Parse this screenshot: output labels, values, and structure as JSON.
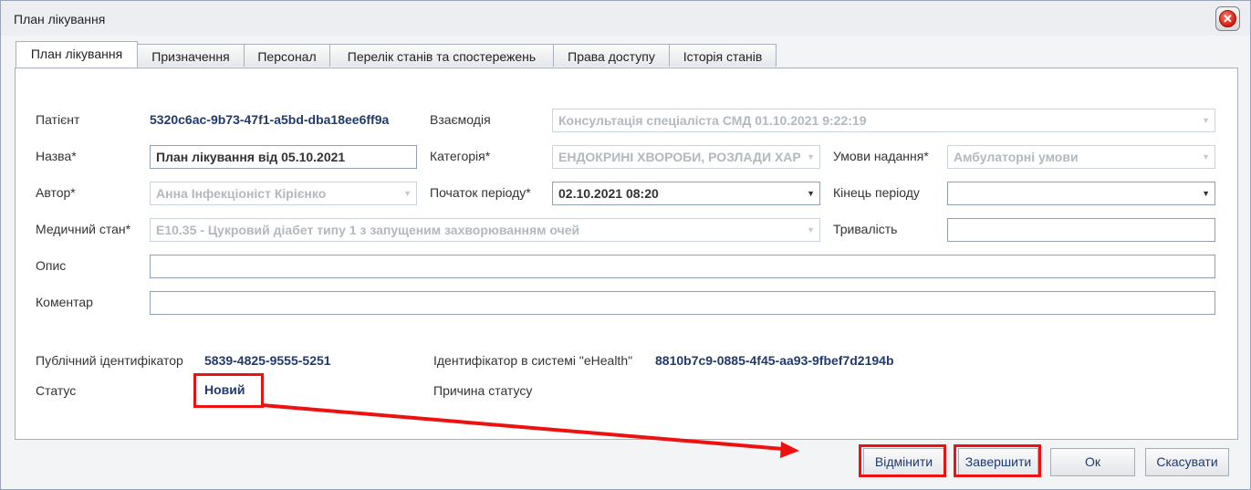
{
  "window": {
    "title": "План лікування"
  },
  "tabs": [
    {
      "label": "План лікування"
    },
    {
      "label": "Призначення"
    },
    {
      "label": "Персонал"
    },
    {
      "label": "Перелік станів та спостережень"
    },
    {
      "label": "Права доступу"
    },
    {
      "label": "Історія станів"
    }
  ],
  "form": {
    "patient_label": "Патієнт",
    "patient_value": "5320c6ac-9b73-47f1-a5bd-dba18ee6ff9a",
    "interaction_label": "Взаємодія",
    "interaction_value": "Консультація спеціаліста СМД 01.10.2021 9:22:19",
    "name_label": "Назва*",
    "name_value": "План лікування від 05.10.2021",
    "category_label": "Категорія*",
    "category_value": "ЕНДОКРИНІ ХВОРОБИ, РОЗЛАДИ ХАРЧУВАННЯ",
    "conditions_label": "Умови надання*",
    "conditions_value": "Амбулаторні умови",
    "author_label": "Автор*",
    "author_value": "Анна Інфекціоніст Кірієнко",
    "period_start_label": "Початок періоду*",
    "period_start_value": "02.10.2021 08:20",
    "period_end_label": "Кінець періоду",
    "period_end_value": "",
    "medical_state_label": "Медичний стан*",
    "medical_state_value": "E10.35 - Цукровий діабет типу 1 з запущеним захворюванням очей",
    "duration_label": "Тривалість",
    "duration_value": "",
    "description_label": "Опис",
    "description_value": "",
    "comment_label": "Коментар",
    "comment_value": "",
    "public_id_label": "Публічний ідентифікатор",
    "public_id_value": "5839-4825-9555-5251",
    "ehealth_id_label": "Ідентифікатор в системі \"eHealth\"",
    "ehealth_id_value": "8810b7c9-0885-4f45-aa93-9fbef7d2194b",
    "status_label": "Статус",
    "status_value": "Новий",
    "status_reason_label": "Причина статусу"
  },
  "buttons": {
    "revoke": "Відмінити",
    "complete": "Завершити",
    "ok": "Ок",
    "cancel": "Скасувати"
  },
  "icons": {
    "close": "close-icon",
    "dropdown": "chevron-down-icon",
    "annotation_arrow": "arrow-right-icon"
  },
  "colors": {
    "highlight": "#ee1111",
    "value_text": "#1f3a6e"
  }
}
